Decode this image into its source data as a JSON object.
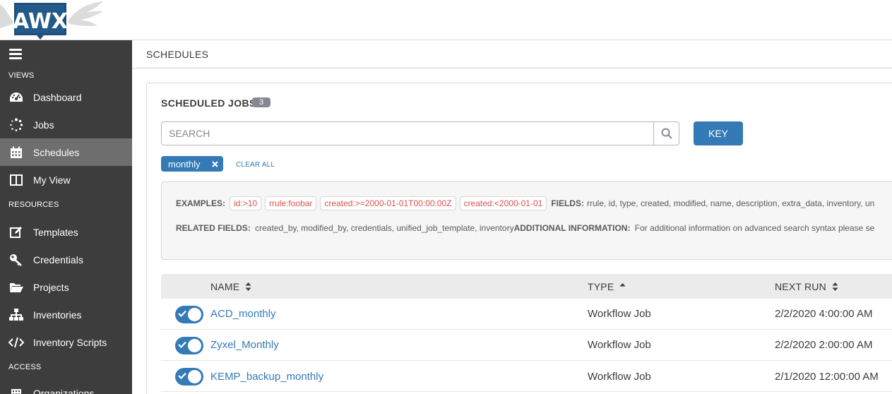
{
  "brand": {
    "logo_text": "AWX"
  },
  "sidebar": {
    "sections": {
      "views": "VIEWS",
      "resources": "RESOURCES",
      "access": "ACCESS"
    },
    "items": [
      {
        "label": "Dashboard",
        "icon": "dashboard-icon"
      },
      {
        "label": "Jobs",
        "icon": "jobs-icon"
      },
      {
        "label": "Schedules",
        "icon": "calendar-icon",
        "active": true
      },
      {
        "label": "My View",
        "icon": "my-view-icon"
      },
      {
        "label": "Templates",
        "icon": "templates-icon"
      },
      {
        "label": "Credentials",
        "icon": "key-icon"
      },
      {
        "label": "Projects",
        "icon": "folder-icon"
      },
      {
        "label": "Inventories",
        "icon": "sitemap-icon"
      },
      {
        "label": "Inventory Scripts",
        "icon": "code-icon"
      },
      {
        "label": "Organizations",
        "icon": "building-icon"
      }
    ]
  },
  "breadcrumb": {
    "title": "SCHEDULES"
  },
  "panel": {
    "title": "SCHEDULED JOBS",
    "count": "3",
    "search_placeholder": "SEARCH",
    "key_label": "KEY",
    "active_tag": "monthly",
    "clear_all": "CLEAR ALL"
  },
  "examples": {
    "label": "EXAMPLES:",
    "chips": [
      "id:>10",
      "rrule:foobar",
      "created:>=2000-01-01T00:00:00Z",
      "created:<2000-01-01"
    ],
    "fields_label": "FIELDS:",
    "fields": "rrule, id, type, created, modified, name, description, extra_data, inventory, un",
    "related_label": "RELATED FIELDS:",
    "related": "created_by, modified_by, credentials, unified_job_template, inventory",
    "additional_label": "ADDITIONAL INFORMATION:",
    "additional": "For additional information on advanced search syntax please se"
  },
  "table": {
    "columns": {
      "name": "NAME",
      "type": "TYPE",
      "next_run": "NEXT RUN"
    },
    "rows": [
      {
        "name": "ACD_monthly",
        "type": "Workflow Job",
        "next_run": "2/2/2020 4:00:00 AM",
        "enabled": true
      },
      {
        "name": "Zyxel_Monthly",
        "type": "Workflow Job",
        "next_run": "2/2/2020 2:00:00 AM",
        "enabled": true
      },
      {
        "name": "KEMP_backup_monthly",
        "type": "Workflow Job",
        "next_run": "2/1/2020 12:00:00 AM",
        "enabled": true
      }
    ]
  },
  "colors": {
    "sidebar_bg": "#3d3d3d",
    "sidebar_active": "#6e6e6e",
    "accent": "#337ab7",
    "example_chip_text": "#d9534f"
  }
}
